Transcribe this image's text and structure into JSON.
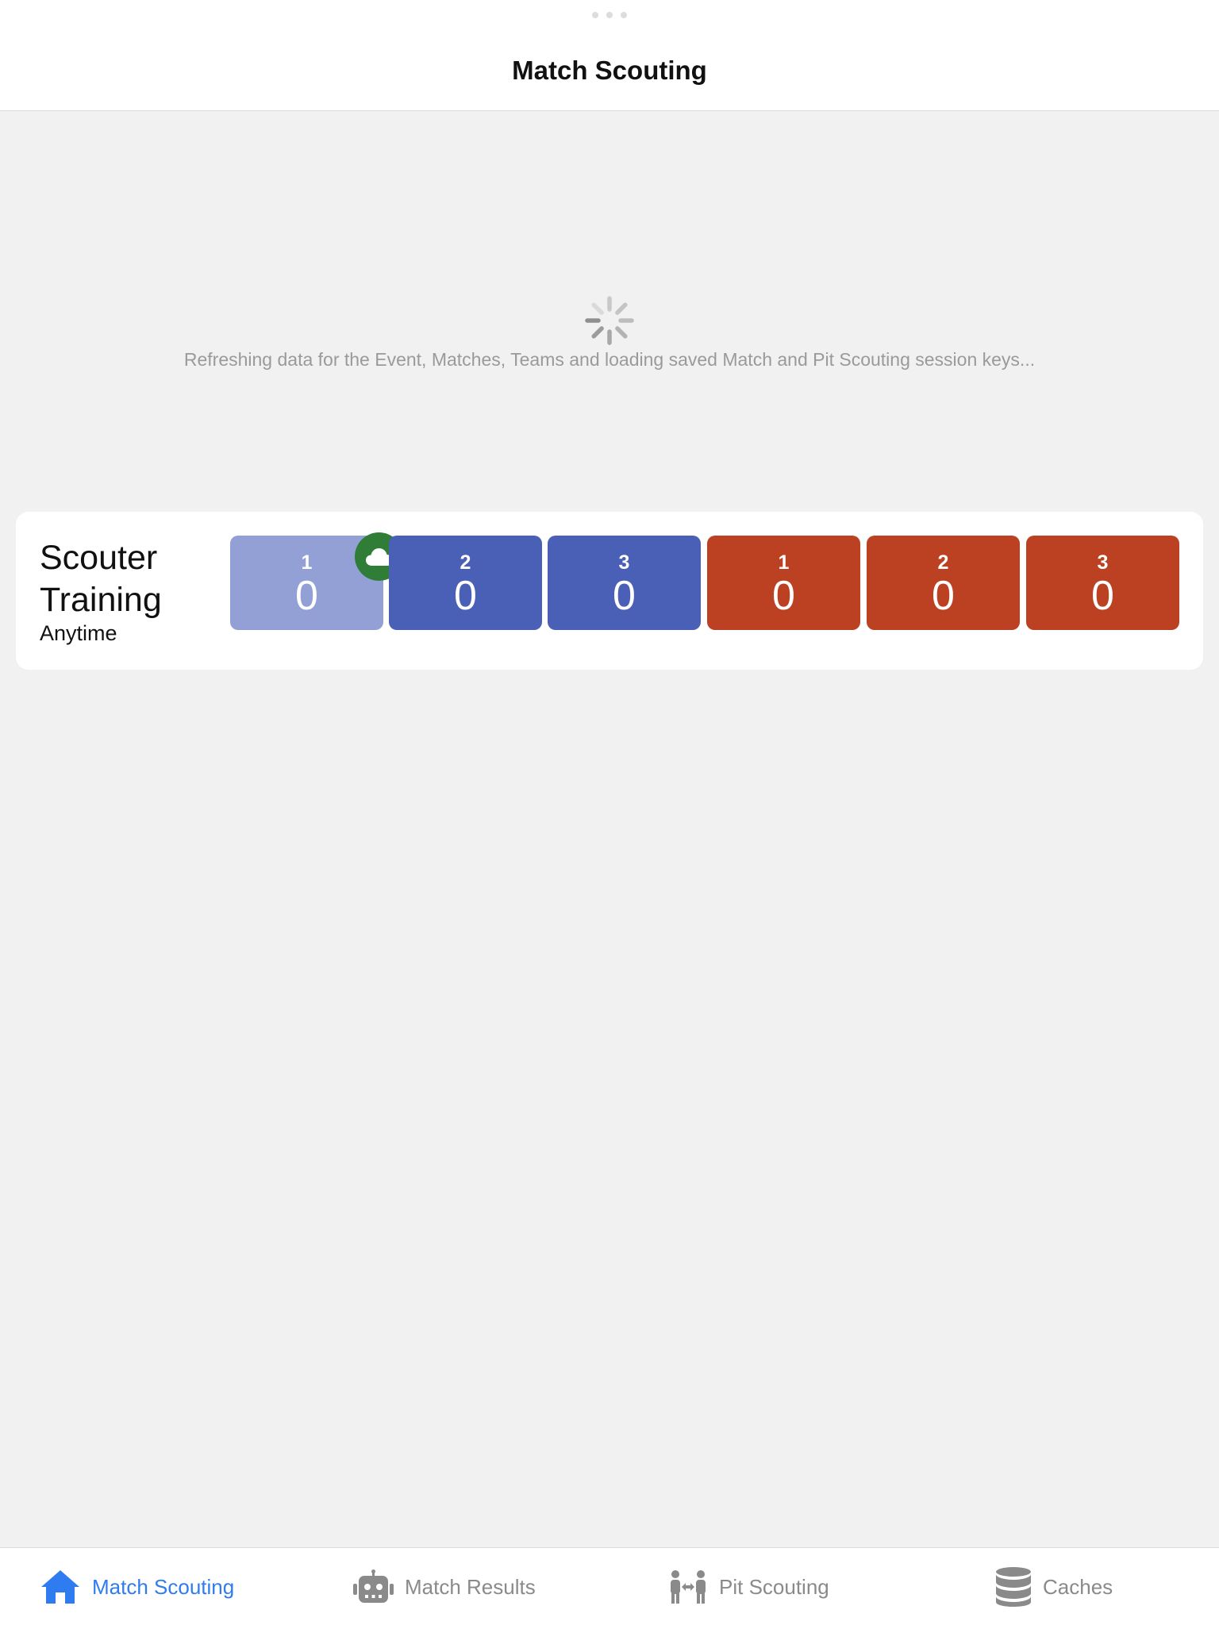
{
  "header": {
    "title": "Match Scouting"
  },
  "loading": {
    "message": "Refreshing data for the Event, Matches, Teams and loading saved Match and Pit Scouting session keys..."
  },
  "match": {
    "name": "Scouter Training",
    "time": "Anytime",
    "slots": [
      {
        "alliance": "blue",
        "number": "1",
        "score": "0",
        "color": "#93a0d6",
        "badge": "cloud-icon"
      },
      {
        "alliance": "blue",
        "number": "2",
        "score": "0",
        "color": "#4a60b6"
      },
      {
        "alliance": "blue",
        "number": "3",
        "score": "0",
        "color": "#4a60b6"
      },
      {
        "alliance": "red",
        "number": "1",
        "score": "0",
        "color": "#bb4122"
      },
      {
        "alliance": "red",
        "number": "2",
        "score": "0",
        "color": "#bb4122"
      },
      {
        "alliance": "red",
        "number": "3",
        "score": "0",
        "color": "#bb4122"
      }
    ]
  },
  "tabs": [
    {
      "label": "Match Scouting",
      "icon": "home-icon",
      "active": true
    },
    {
      "label": "Match Results",
      "icon": "robot-icon",
      "active": false
    },
    {
      "label": "Pit Scouting",
      "icon": "people-icon",
      "active": false
    },
    {
      "label": "Caches",
      "icon": "database-icon",
      "active": false
    }
  ],
  "colors": {
    "accent": "#2f7bf0",
    "blue_alliance": "#4a60b6",
    "red_alliance": "#bb4122",
    "badge": "#2f7d37"
  }
}
